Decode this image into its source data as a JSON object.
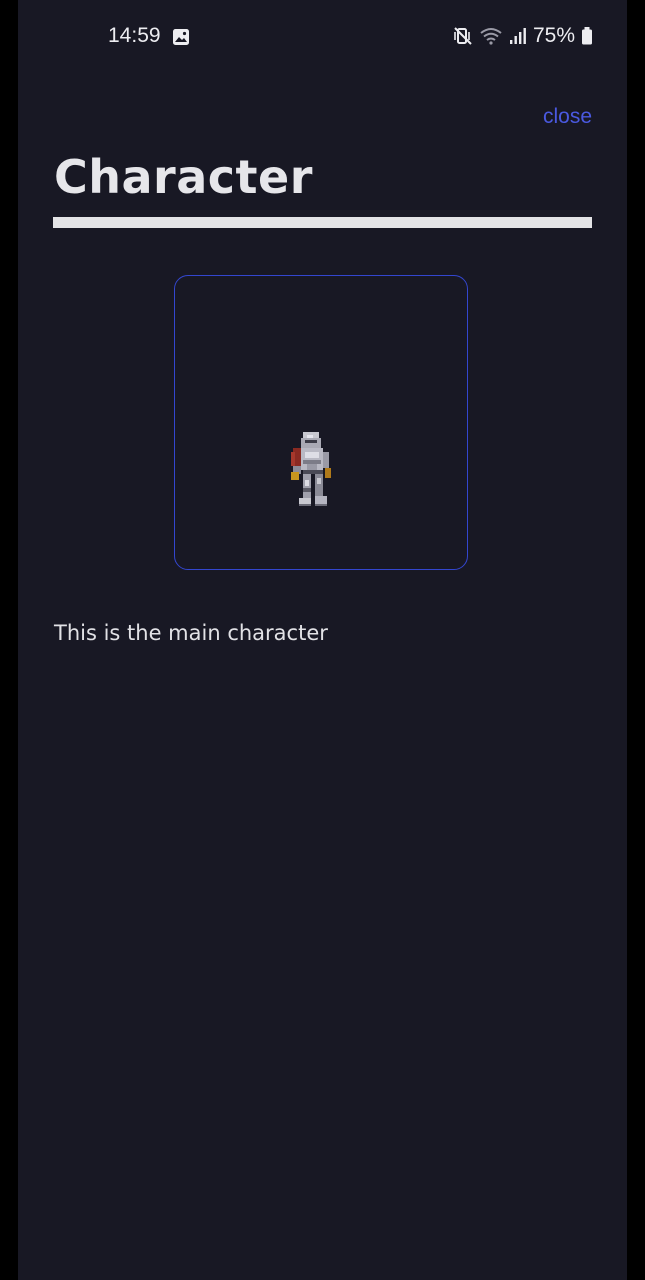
{
  "status_bar": {
    "time": "14:59",
    "battery": "75%",
    "icons": [
      "gallery-icon",
      "mute-vibrate-icon",
      "wifi-icon",
      "signal-icon",
      "battery-icon"
    ]
  },
  "header": {
    "close_label": "close",
    "title": "Character"
  },
  "character": {
    "sprite_icon": "knight-sprite",
    "description": "This is the main character"
  },
  "colors": {
    "background": "#181824",
    "accent": "#4a59e0",
    "frame_border": "#3346cf",
    "text": "#e6e6ea"
  }
}
